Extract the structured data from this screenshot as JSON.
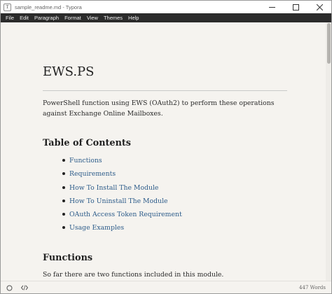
{
  "window": {
    "title": "sample_readme.md - Typora",
    "app_icon_glyph": "T",
    "icons": {
      "app": "typora-app-icon",
      "minimize": "minimize-icon",
      "maximize": "maximize-icon",
      "close": "close-icon"
    }
  },
  "menubar": {
    "items": [
      "File",
      "Edit",
      "Paragraph",
      "Format",
      "View",
      "Themes",
      "Help"
    ]
  },
  "document": {
    "title": "EWS.PS",
    "intro": "PowerShell function using EWS (OAuth2) to perform these operations against Exchange Online Mailboxes.",
    "toc_heading": "Table of Contents",
    "toc_items": [
      "Functions",
      "Requirements",
      "How To Install The Module",
      "How To Uninstall The Module",
      "OAuth Access Token Requirement",
      "Usage Examples"
    ],
    "functions_heading": "Functions",
    "functions_intro": "So far there are two functions included in this module."
  },
  "statusbar": {
    "word_count": "447 Words",
    "icons": {
      "outline": "circle-outline-icon",
      "source": "source-code-icon"
    }
  },
  "colors": {
    "background": "#f5f3ef",
    "menubar": "#2b2b2b",
    "link": "#2d5c8a"
  }
}
